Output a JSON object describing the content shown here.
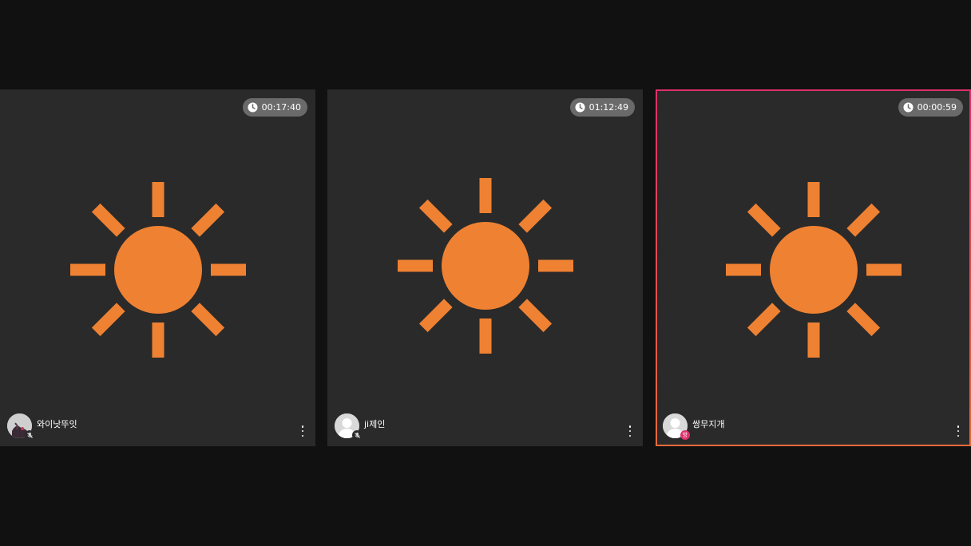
{
  "colors": {
    "background": "#111111",
    "tile": "#2a2a2a",
    "sun": "#ef8132",
    "active_border_top": "#e0306a",
    "active_border_bottom": "#ea6a3a",
    "timer_pill": "#6a6a6a"
  },
  "tiles": [
    {
      "timer": "00:17:40",
      "name": "와이낫뚜잇",
      "avatar": "photo-avatar",
      "status_icon": "mic-off-icon",
      "active": false
    },
    {
      "timer": "01:12:49",
      "name": "ji제인",
      "avatar": "default-avatar",
      "status_icon": "mic-off-icon",
      "active": false
    },
    {
      "timer": "00:00:59",
      "name": "쌍무지개",
      "avatar": "default-avatar",
      "status_icon": "host-badge-icon",
      "host_badge": "방",
      "active": true
    }
  ]
}
